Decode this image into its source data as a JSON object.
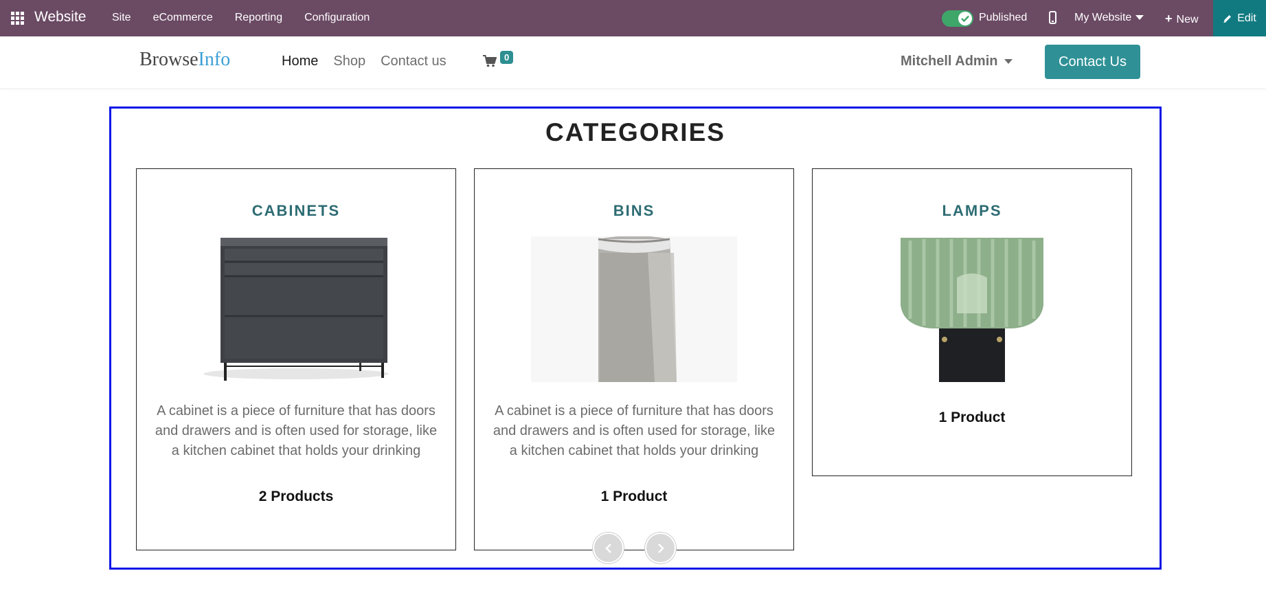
{
  "admin_bar": {
    "app_name": "Website",
    "menu": [
      "Site",
      "eCommerce",
      "Reporting",
      "Configuration"
    ],
    "publish_label": "Published",
    "published": true,
    "website_selector": "My Website",
    "new_label": "New",
    "edit_label": "Edit",
    "bar_color": "#6b4a64",
    "edit_color": "#117a80"
  },
  "site_header": {
    "logo_part1": "Browse",
    "logo_part2": "Info",
    "nav": [
      {
        "label": "Home",
        "active": true
      },
      {
        "label": "Shop",
        "active": false
      },
      {
        "label": "Contact us",
        "active": false
      }
    ],
    "cart_count": "0",
    "user_name": "Mitchell Admin",
    "contact_button": "Contact Us",
    "accent_color": "#2f9196"
  },
  "categories": {
    "title": "CATEGORIES",
    "items": [
      {
        "name": "CABINETS",
        "description": "A cabinet is a piece of furniture that has doors and drawers and is often used for storage, like a kitchen cabinet that holds your drinking",
        "count": "2 Products",
        "image": "dark-grey-chest-of-drawers"
      },
      {
        "name": "BINS",
        "description": "A cabinet is a piece of furniture that has doors and drawers and is often used for storage, like a kitchen cabinet that holds your drinking",
        "count": "1 Product",
        "image": "perforated-metal-bin"
      },
      {
        "name": "LAMPS",
        "description": "",
        "count": "1 Product",
        "image": "green-glass-lamp"
      }
    ],
    "prev_icon": "chevron-left-icon",
    "next_icon": "chevron-right-icon",
    "frame_color": "#0b16e6"
  }
}
